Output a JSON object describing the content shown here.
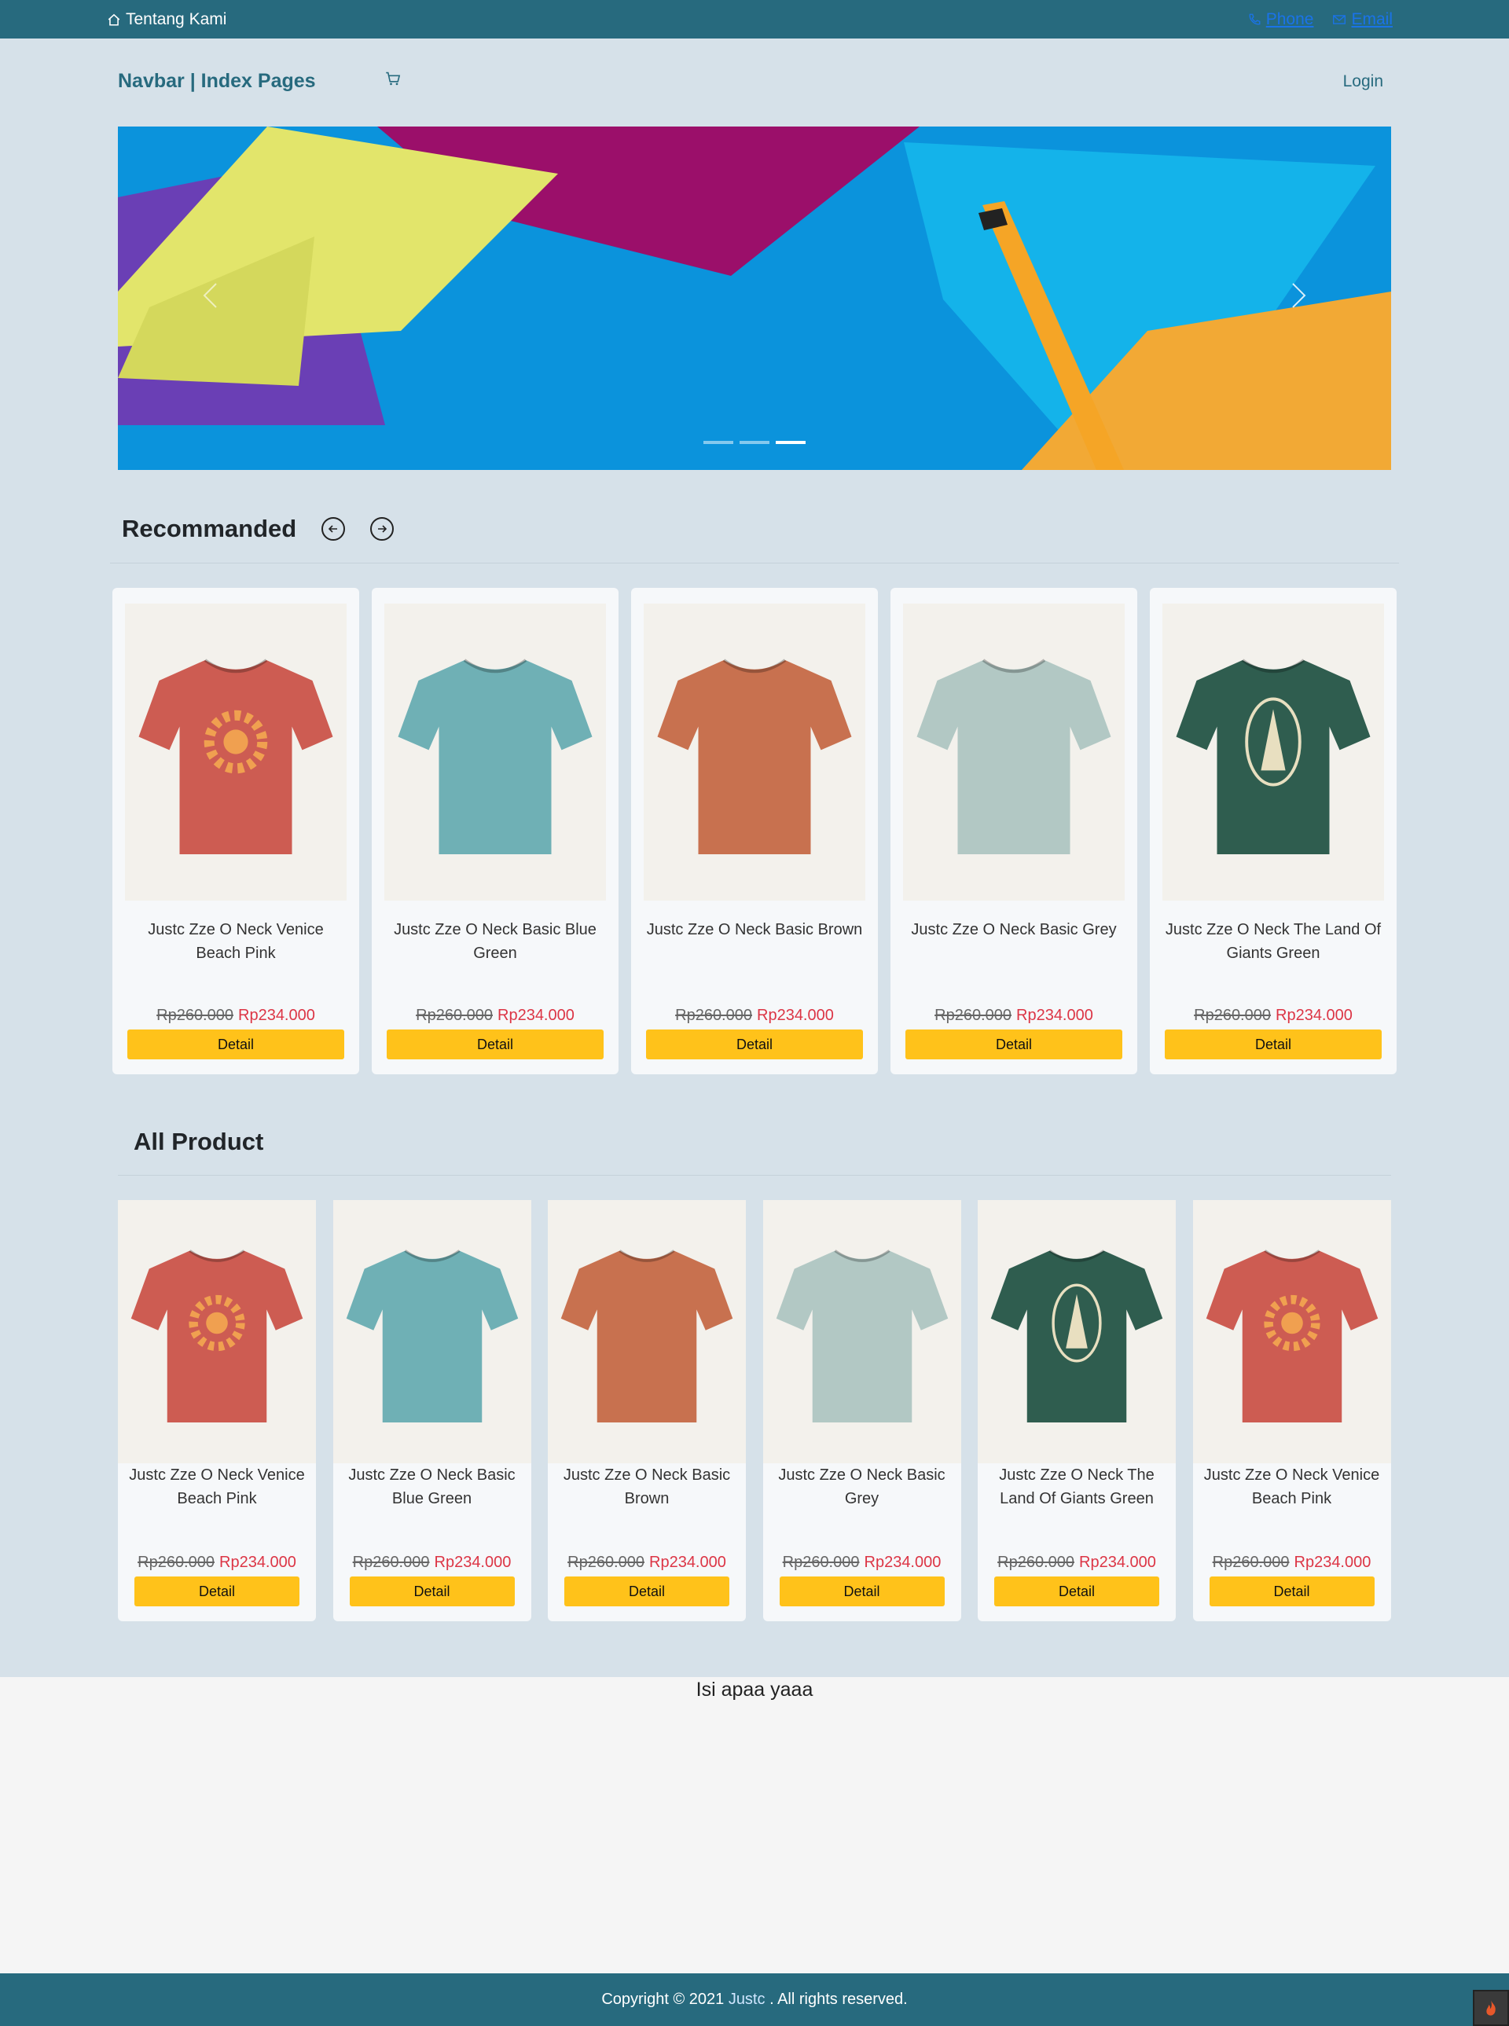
{
  "topbar": {
    "about_label": "Tentang Kami",
    "phone_label": "Phone",
    "email_label": "Email"
  },
  "navbar": {
    "brand": "Navbar | Index Pages",
    "login_label": "Login"
  },
  "carousel": {
    "slide_count": 3,
    "active_index": 2
  },
  "recommended": {
    "title": "Recommanded",
    "products": [
      {
        "name": "Justc Zze O Neck Venice Beach Pink",
        "old_price": "Rp260.000",
        "price": "Rp234.000",
        "button": "Detail",
        "color": "#cd5c52",
        "print": "sun"
      },
      {
        "name": "Justc Zze O Neck Basic Blue Green",
        "old_price": "Rp260.000",
        "price": "Rp234.000",
        "button": "Detail",
        "color": "#6fb0b5",
        "print": "none"
      },
      {
        "name": "Justc Zze O Neck Basic Brown",
        "old_price": "Rp260.000",
        "price": "Rp234.000",
        "button": "Detail",
        "color": "#c8714f",
        "print": "none"
      },
      {
        "name": "Justc Zze O Neck Basic Grey",
        "old_price": "Rp260.000",
        "price": "Rp234.000",
        "button": "Detail",
        "color": "#b2c8c4",
        "print": "none"
      },
      {
        "name": "Justc Zze O Neck The Land Of Giants Green",
        "old_price": "Rp260.000",
        "price": "Rp234.000",
        "button": "Detail",
        "color": "#2f5d4f",
        "print": "tree"
      }
    ]
  },
  "all_products": {
    "title": "All Product",
    "products": [
      {
        "name": "Justc Zze O Neck Venice Beach Pink",
        "old_price": "Rp260.000",
        "price": "Rp234.000",
        "button": "Detail",
        "color": "#cd5c52",
        "print": "sun"
      },
      {
        "name": "Justc Zze O Neck Basic Blue Green",
        "old_price": "Rp260.000",
        "price": "Rp234.000",
        "button": "Detail",
        "color": "#6fb0b5",
        "print": "none"
      },
      {
        "name": "Justc Zze O Neck Basic Brown",
        "old_price": "Rp260.000",
        "price": "Rp234.000",
        "button": "Detail",
        "color": "#c8714f",
        "print": "none"
      },
      {
        "name": "Justc Zze O Neck Basic Grey",
        "old_price": "Rp260.000",
        "price": "Rp234.000",
        "button": "Detail",
        "color": "#b2c8c4",
        "print": "none"
      },
      {
        "name": "Justc Zze O Neck The Land Of Giants Green",
        "old_price": "Rp260.000",
        "price": "Rp234.000",
        "button": "Detail",
        "color": "#2f5d4f",
        "print": "tree"
      },
      {
        "name": "Justc Zze O Neck Venice Beach Pink",
        "old_price": "Rp260.000",
        "price": "Rp234.000",
        "button": "Detail",
        "color": "#cd5c52",
        "print": "sun"
      }
    ]
  },
  "content": {
    "placeholder_text": "Isi apaa yaaa"
  },
  "footer": {
    "prefix": "Copyright © 2021",
    "brand": "Justc",
    "suffix": ". All rights reserved."
  }
}
